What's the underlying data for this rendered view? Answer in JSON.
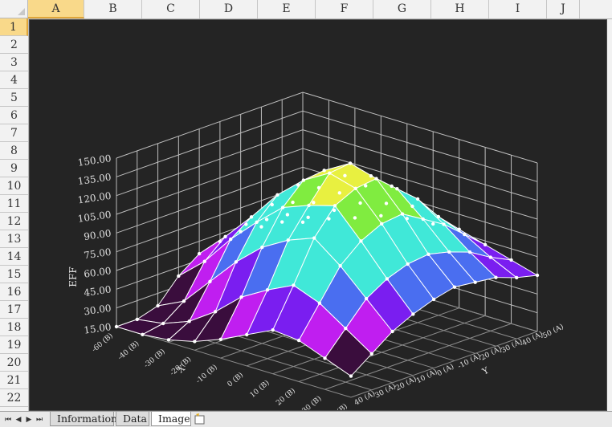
{
  "columns": [
    "A",
    "B",
    "C",
    "D",
    "E",
    "F",
    "G",
    "H",
    "I",
    "J"
  ],
  "selected_column": "A",
  "rows": [
    "1",
    "2",
    "3",
    "4",
    "5",
    "6",
    "7",
    "8",
    "9",
    "10",
    "11",
    "12",
    "13",
    "14",
    "15",
    "16",
    "17",
    "18",
    "19",
    "20",
    "21",
    "22"
  ],
  "selected_row": "1",
  "sheet_tabs": [
    {
      "label": "Information",
      "active": false
    },
    {
      "label": "Data",
      "active": false
    },
    {
      "label": "Image",
      "active": true
    }
  ],
  "colors": {
    "chart_background": "#242424",
    "band_1": "#3a0d3d",
    "band_2": "#c01ef0",
    "band_3": "#7a1ef0",
    "band_4": "#4a6ef0",
    "band_5": "#40e8d8",
    "band_6": "#80ec40",
    "band_7": "#e8f040"
  },
  "chart_data": {
    "type": "surface3d",
    "zlabel": "EFF",
    "xlabel": "X",
    "ylabel": "Y",
    "z_ticks": [
      "15.00",
      "30.00",
      "45.00",
      "60.00",
      "75.00",
      "90.00",
      "105.00",
      "120.00",
      "135.00",
      "150.00"
    ],
    "zlim": [
      15,
      150
    ],
    "x_ticks": [
      "-60 (B)",
      "-40 (B)",
      "-30 (B)",
      "-20 (B)",
      "-10 (B)",
      "0 (B)",
      "10 (B)",
      "20 (B)",
      "30 (B)",
      "40 (B)"
    ],
    "y_ticks": [
      "40 (A)",
      "30 (A)",
      "20 (A)",
      "10 (A)",
      "0 (A)",
      "-10 (A)",
      "-20 (A)",
      "-30 (A)",
      "-40 (A)",
      "-50 (A)"
    ],
    "bands": [
      15,
      30,
      45,
      60,
      75,
      90,
      105,
      120,
      135,
      150
    ],
    "grid": true,
    "z": [
      [
        46,
        55,
        62,
        70,
        74,
        76,
        78,
        72,
        66,
        60
      ],
      [
        52,
        62,
        74,
        86,
        92,
        96,
        94,
        86,
        74,
        64
      ],
      [
        54,
        70,
        86,
        100,
        112,
        118,
        114,
        100,
        84,
        70
      ],
      [
        56,
        72,
        92,
        110,
        126,
        132,
        128,
        110,
        90,
        72
      ],
      [
        54,
        74,
        96,
        118,
        136,
        148,
        142,
        120,
        94,
        74
      ],
      [
        50,
        70,
        92,
        116,
        134,
        146,
        140,
        118,
        92,
        70
      ],
      [
        38,
        56,
        80,
        100,
        118,
        126,
        132,
        110,
        86,
        64
      ],
      [
        20,
        30,
        52,
        74,
        92,
        104,
        112,
        96,
        76,
        56
      ],
      [
        15,
        18,
        26,
        40,
        58,
        70,
        80,
        72,
        58,
        44
      ],
      [
        15,
        15,
        17,
        22,
        30,
        40,
        50,
        48,
        40,
        32
      ]
    ]
  }
}
